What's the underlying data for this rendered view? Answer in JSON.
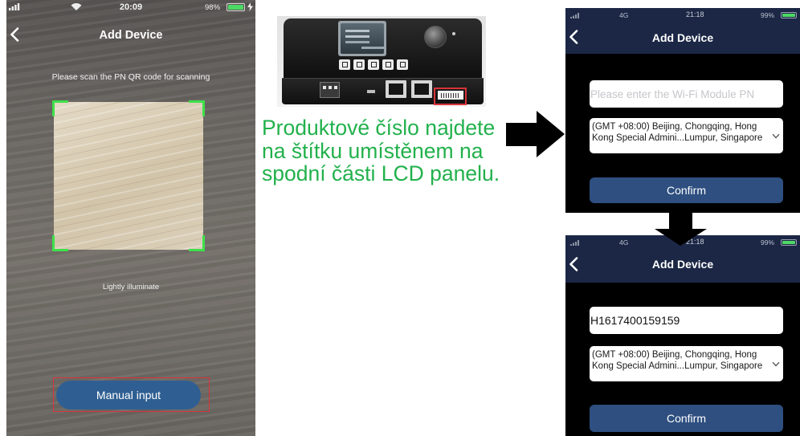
{
  "left_phone": {
    "status_bar": {
      "time": "20:09",
      "battery": "98%"
    },
    "nav": {
      "back_icon": "chevron-left-icon",
      "title": "Add Device"
    },
    "scan_instruction": "Please scan the PN QR code for scanning",
    "scan_hint": "Lightly illuminate",
    "manual_input_button": "Manual input"
  },
  "caption": {
    "lines": [
      "Produktové číslo najdete",
      "na štítku umístěnem na",
      "spodní části LCD panelu."
    ]
  },
  "setup_screens": [
    {
      "status_bar": {
        "network": "4G",
        "time": "21:18",
        "battery": "99%"
      },
      "nav": {
        "back_icon": "chevron-left-icon",
        "title": "Add Device"
      },
      "pn_input": {
        "placeholder": "Please enter the Wi-Fi Module PN"
      },
      "timezone_select": {
        "selected": "(GMT +08:00) Beijing, Chongqing, Hong Kong Special Admini...Lumpur, Singapore",
        "icon": "chevron-down-icon"
      },
      "confirm_button": "Confirm"
    },
    {
      "status_bar": {
        "network": "4G",
        "time": "21:18",
        "battery": "99%"
      },
      "nav": {
        "back_icon": "chevron-left-icon",
        "title": "Add Device"
      },
      "pn_input": {
        "value": "H1617400159159"
      },
      "timezone_select": {
        "selected": "(GMT +08:00) Beijing, Chongqing, Hong Kong Special Admini...Lumpur, Singapore",
        "icon": "chevron-down-icon"
      },
      "confirm_button": "Confirm"
    }
  ],
  "status_icons": [
    "signal-icon",
    "wifi-icon",
    "battery-icon",
    "charging-icon"
  ],
  "flow_icons": [
    "arrow-right-icon",
    "arrow-down-icon"
  ],
  "colors": {
    "caption": "#22b14c",
    "highlight_box": "#d9333a",
    "scan_corner": "#3ee04b",
    "manual_button": "#2f5f92",
    "primary_button": "#2e4f80",
    "header": "#1b2745",
    "battery": "#4cd964"
  }
}
